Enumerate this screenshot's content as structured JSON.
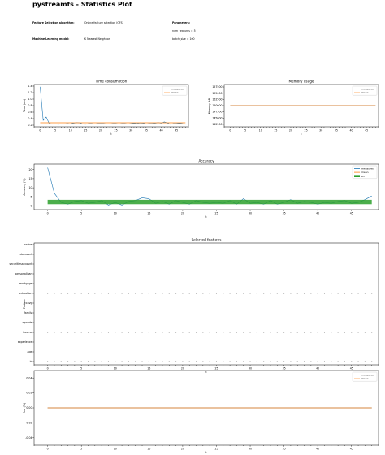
{
  "header": {
    "title": "pystreamfs -  Statistics Plot",
    "fs_algorithm_label": "Feature Selection algorithm:",
    "fs_algorithm_value": "Online feature selection (OFS)",
    "ml_model_label": "Machine Learning model:",
    "ml_model_value": "K Nearest Neighbor",
    "params_label": "Parameters:",
    "param_1": "num_features = 5",
    "param_2": "batch_size = 100"
  },
  "colors": {
    "measures": "#1f77b4",
    "mean": "#ff7f0e",
    "sd": "#2ca02c",
    "selected": "#7f7f7f"
  },
  "chart_data": [
    {
      "id": "time",
      "type": "line",
      "title": "Time consumption",
      "xlabel": "t",
      "ylabel": "Time (ms)",
      "xlim": [
        -2,
        49
      ],
      "ylim": [
        0.15,
        1.45
      ],
      "xticks": [
        0,
        5,
        10,
        15,
        20,
        25,
        30,
        35,
        40,
        45
      ],
      "yticks": [
        0.2,
        0.4,
        0.6,
        0.8,
        1.0,
        1.2,
        1.4
      ],
      "ytick_labels": [
        "0.2",
        "0.4",
        "0.6",
        "0.8",
        "1.0",
        "1.2",
        "1.4"
      ],
      "legend": [
        "measures",
        "mean"
      ],
      "legend_position": "top-right",
      "series": [
        {
          "name": "measures",
          "values": [
            1.38,
            0.35,
            0.45,
            0.25,
            0.24,
            0.24,
            0.23,
            0.24,
            0.24,
            0.25,
            0.24,
            0.26,
            0.28,
            0.27,
            0.24,
            0.23,
            0.25,
            0.25,
            0.24,
            0.25,
            0.25,
            0.25,
            0.24,
            0.24,
            0.25,
            0.25,
            0.24,
            0.25,
            0.25,
            0.24,
            0.25,
            0.26,
            0.25,
            0.27,
            0.26,
            0.24,
            0.25,
            0.25,
            0.26,
            0.28,
            0.26,
            0.3,
            0.27,
            0.23,
            0.25,
            0.25,
            0.26,
            0.25,
            0.23
          ]
        },
        {
          "name": "mean",
          "constant": 0.275
        }
      ]
    },
    {
      "id": "memory",
      "type": "line",
      "title": "Memory usage",
      "xlabel": "t",
      "ylabel": "Memory (kB)",
      "xlim": [
        -2,
        49
      ],
      "ylim": [
        141500,
        158500
      ],
      "xticks": [
        0,
        5,
        10,
        15,
        20,
        25,
        30,
        35,
        40,
        45
      ],
      "yticks": [
        142500,
        145000,
        147500,
        150000,
        152500,
        155000,
        157500
      ],
      "ytick_labels": [
        "142500",
        "145000",
        "147500",
        "150000",
        "152500",
        "155000",
        "157500"
      ],
      "legend": [
        "measures",
        "mean"
      ],
      "legend_position": "top-right",
      "series": [
        {
          "name": "measures",
          "constant": 150000
        },
        {
          "name": "mean",
          "constant": 150000
        }
      ]
    },
    {
      "id": "accuracy",
      "type": "line",
      "title": "Accuracy",
      "xlabel": "t",
      "ylabel": "Accuracy (%)",
      "xlim": [
        -2,
        49
      ],
      "ylim": [
        -2,
        23
      ],
      "xticks": [
        0,
        5,
        10,
        15,
        20,
        25,
        30,
        35,
        40,
        45
      ],
      "yticks": [
        0,
        5,
        10,
        15,
        20
      ],
      "ytick_labels": [
        "0",
        "5",
        "10",
        "15",
        "20"
      ],
      "legend": [
        "measures",
        "mean",
        "sd"
      ],
      "legend_position": "top-right",
      "series": [
        {
          "name": "measures",
          "values": [
            21,
            7,
            2,
            1,
            2.5,
            3,
            1.5,
            2,
            3,
            0.5,
            2,
            0.5,
            2.5,
            3,
            4.5,
            4,
            1.5,
            2.5,
            1,
            3,
            2,
            1,
            3,
            2,
            1.5,
            2,
            1.5,
            3,
            1,
            4,
            1.5,
            2,
            1,
            3,
            1,
            2,
            3.5,
            1.5,
            2.5,
            2,
            1,
            2,
            1.5,
            2.5,
            3,
            1.5,
            2,
            3.5,
            5.5
          ]
        },
        {
          "name": "mean",
          "constant": 2.2
        },
        {
          "name": "sd",
          "band": [
            1.0,
            3.4
          ]
        }
      ]
    },
    {
      "id": "selected",
      "type": "scatter",
      "title": "Selected features",
      "xlabel": "t",
      "ylabel": "Feature",
      "categories": [
        "id",
        "age",
        "experience",
        "income",
        "zipcode",
        "family",
        "ccavg",
        "education",
        "mortgage",
        "personalloan",
        "securitiesaccount",
        "cdaccount",
        "online"
      ],
      "selected_categories": [
        "id",
        "income",
        "education"
      ],
      "xlim": [
        -2,
        49
      ],
      "xticks": [
        0,
        5,
        10,
        15,
        20,
        25,
        30,
        35,
        40,
        45
      ]
    },
    {
      "id": "fscr",
      "type": "line",
      "xlabel": "t",
      "ylabel": "fscr (%)",
      "xlim": [
        -2,
        49
      ],
      "ylim": [
        -0.05,
        0.05
      ],
      "xticks": [
        0,
        5,
        10,
        15,
        20,
        25,
        30,
        35,
        40,
        45
      ],
      "yticks": [
        -0.04,
        -0.02,
        0.0,
        0.02,
        0.04
      ],
      "ytick_labels": [
        "-0.04",
        "-0.02",
        "0.00",
        "0.02",
        "0.04"
      ],
      "legend": [
        "measures",
        "mean"
      ],
      "legend_position": "top-right",
      "series": [
        {
          "name": "measures",
          "constant": 0
        },
        {
          "name": "mean",
          "constant": 0
        }
      ]
    }
  ]
}
